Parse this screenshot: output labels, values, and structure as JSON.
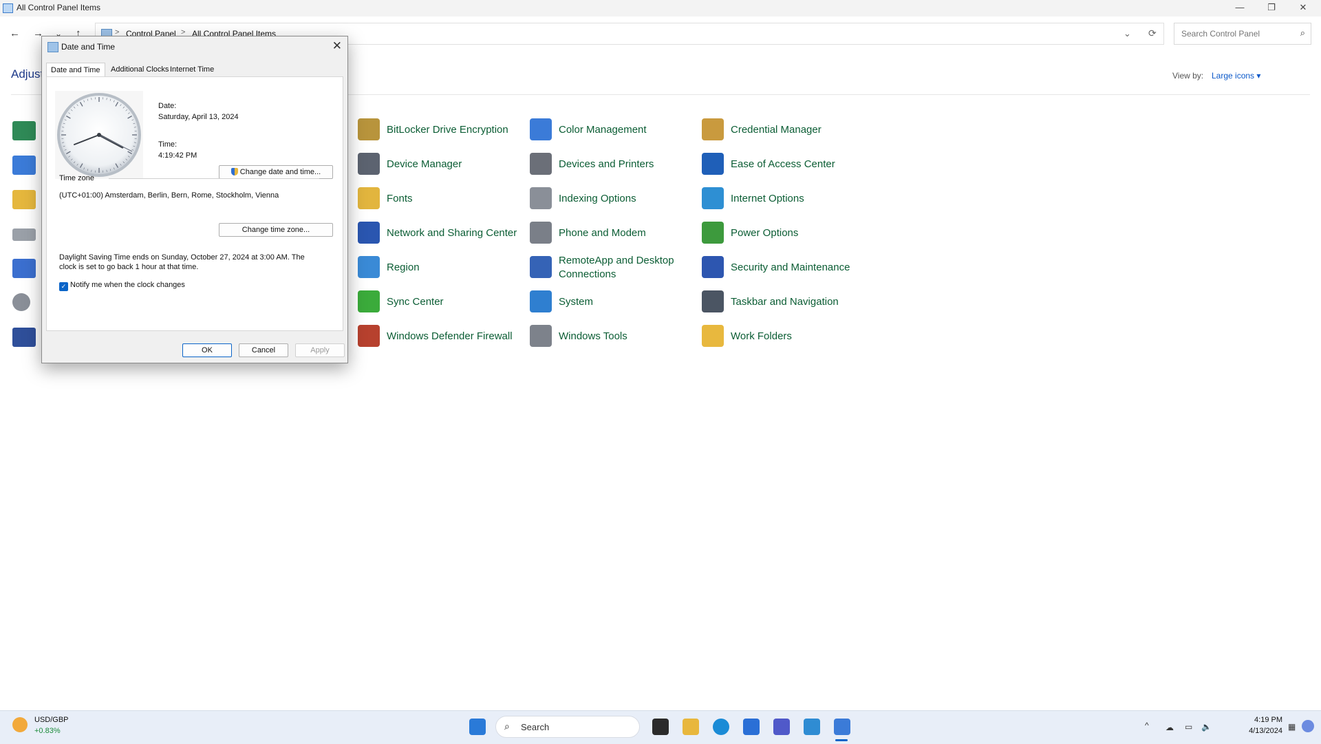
{
  "window": {
    "title": "All Control Panel Items",
    "controls": {
      "minimize": "—",
      "restore": "❐",
      "close": "✕"
    }
  },
  "nav": {
    "back": "←",
    "forward": "→",
    "recent": "⌄",
    "up": "↑"
  },
  "address": {
    "crumbs": [
      "Control Panel",
      "All Control Panel Items"
    ],
    "separator": ">",
    "dropdown": "⌄",
    "refresh": "⟳"
  },
  "search": {
    "placeholder": "Search Control Panel"
  },
  "page": {
    "heading": "Adjust",
    "view_by_label": "View by:",
    "view_by_value": "Large icons ▾"
  },
  "items": [
    {
      "label": "BitLocker Drive Encryption",
      "icon": "bitlocker-icon",
      "color": "#b8943c"
    },
    {
      "label": "Color Management",
      "icon": "color-management-icon",
      "color": "#3b7bd8"
    },
    {
      "label": "Credential Manager",
      "icon": "credential-manager-icon",
      "color": "#c99a3e"
    },
    {
      "label": "Device Manager",
      "icon": "device-manager-icon",
      "color": "#5c6370"
    },
    {
      "label": "Devices and Printers",
      "icon": "printer-icon",
      "color": "#6b6f78"
    },
    {
      "label": "Ease of Access Center",
      "icon": "ease-of-access-icon",
      "color": "#1f5fb8"
    },
    {
      "label": "Fonts",
      "icon": "fonts-icon",
      "color": "#e2b53e"
    },
    {
      "label": "Indexing Options",
      "icon": "indexing-icon",
      "color": "#8a8f98"
    },
    {
      "label": "Internet Options",
      "icon": "internet-options-icon",
      "color": "#2e8fd3"
    },
    {
      "label": "Network and Sharing Center",
      "icon": "network-icon",
      "color": "#2a56b0"
    },
    {
      "label": "Phone and Modem",
      "icon": "phone-modem-icon",
      "color": "#7a7f88"
    },
    {
      "label": "Power Options",
      "icon": "power-options-icon",
      "color": "#3d9a3d"
    },
    {
      "label": "Region",
      "icon": "region-icon",
      "color": "#3a8ad6"
    },
    {
      "label": "RemoteApp and Desktop Connections",
      "icon": "remoteapp-icon",
      "color": "#3563b6"
    },
    {
      "label": "Security and Maintenance",
      "icon": "security-flag-icon",
      "color": "#2d56b0"
    },
    {
      "label": "Sync Center",
      "icon": "sync-center-icon",
      "color": "#3bab3b"
    },
    {
      "label": "System",
      "icon": "system-icon",
      "color": "#2f7fd0"
    },
    {
      "label": "Taskbar and Navigation",
      "icon": "taskbar-nav-icon",
      "color": "#4b5563"
    },
    {
      "label": "Windows Defender Firewall",
      "icon": "firewall-icon",
      "color": "#b7412e"
    },
    {
      "label": "Windows Tools",
      "icon": "windows-tools-icon",
      "color": "#7d828b"
    },
    {
      "label": "Work Folders",
      "icon": "work-folders-icon",
      "color": "#e8b83e"
    }
  ],
  "left_icons": [
    {
      "icon": "autoplay-icon",
      "color": "#2f8a57"
    },
    {
      "icon": "calculator-icon",
      "color": "#3b7bd8"
    },
    {
      "icon": "file-explorer-options-icon",
      "color": "#e5b73d"
    },
    {
      "icon": "keyboard-icon",
      "color": "#9aa0a8"
    },
    {
      "icon": "programs-icon",
      "color": "#3b6fcf"
    },
    {
      "icon": "sound-icon",
      "color": "#8a8f98"
    },
    {
      "icon": "recovery-icon",
      "color": "#2f4f9a"
    }
  ],
  "dialog": {
    "title": "Date and Time",
    "close": "✕",
    "tabs": [
      "Date and Time",
      "Additional Clocks",
      "Internet Time"
    ],
    "date_label": "Date:",
    "date_value": "Saturday, April 13, 2024",
    "time_label": "Time:",
    "time_value": "4:19:42 PM",
    "change_datetime_button": "Change date and time...",
    "timezone_heading": "Time zone",
    "timezone_value": "(UTC+01:00) Amsterdam, Berlin, Bern, Rome, Stockholm, Vienna",
    "change_timezone_button": "Change time zone...",
    "dst_line1": "Daylight Saving Time ends on Sunday, October 27, 2024 at 3:00 AM. The",
    "dst_line2": "clock is set to go back 1 hour at that time.",
    "notify_label": "Notify me when the clock changes",
    "notify_checked": true,
    "ok": "OK",
    "cancel": "Cancel",
    "apply": "Apply"
  },
  "taskbar": {
    "widget_title": "USD/GBP",
    "widget_value": "+0.83%",
    "search_label": "Search",
    "apps": [
      {
        "icon": "start-icon",
        "color": "#2a7ad8"
      },
      {
        "icon": "terminal-icon",
        "color": "#2b2b2b"
      },
      {
        "icon": "file-explorer-icon",
        "color": "#e8b73d"
      },
      {
        "icon": "edge-icon",
        "color": "#1b8bd6"
      },
      {
        "icon": "store-icon",
        "color": "#2a6fd6"
      },
      {
        "icon": "teams-icon",
        "color": "#5059c9"
      },
      {
        "icon": "remote-desktop-icon",
        "color": "#2f8cd3"
      },
      {
        "icon": "control-panel-icon",
        "color": "#3b7bd8"
      }
    ],
    "tray_chevron": "^",
    "clock_time": "4:19 PM",
    "clock_date": "4/13/2024"
  }
}
